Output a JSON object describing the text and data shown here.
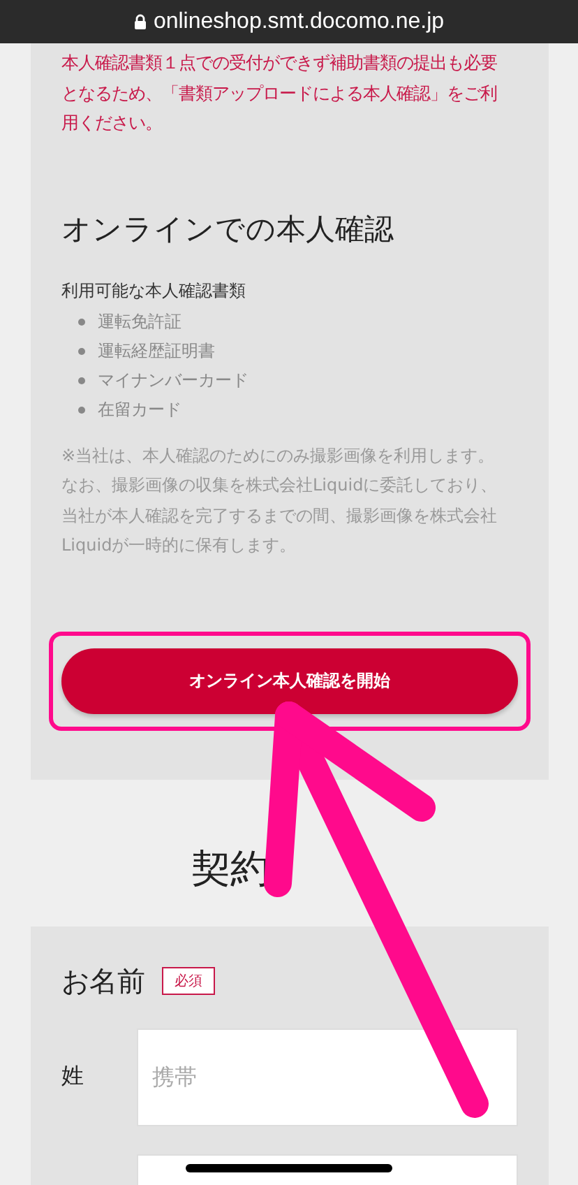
{
  "address_bar": {
    "url": "onlineshop.smt.docomo.ne.jp"
  },
  "notice": {
    "text": "本人確認書類１点での受付ができず補助書類の提出も必要となるため、「書類アップロードによる本人確認」をご利用ください。"
  },
  "online_verification": {
    "title": "オンラインでの本人確認",
    "documents_label": "利用可能な本人確認書類",
    "documents": [
      "運転免許証",
      "運転経歴証明書",
      "マイナンバーカード",
      "在留カード"
    ],
    "note": "※当社は、本人確認のためにのみ撮影画像を利用します。なお、撮影画像の収集を株式会社Liquidに委託しており、当社が本人確認を完了するまでの間、撮影画像を株式会社Liquidが一時的に保有します。",
    "start_button": "オンライン本人確認を開始"
  },
  "contract_info": {
    "title": "契約",
    "name_label": "お名前",
    "required_badge": "必須",
    "fields": [
      {
        "label": "姓",
        "placeholder": "携帯"
      }
    ]
  }
}
